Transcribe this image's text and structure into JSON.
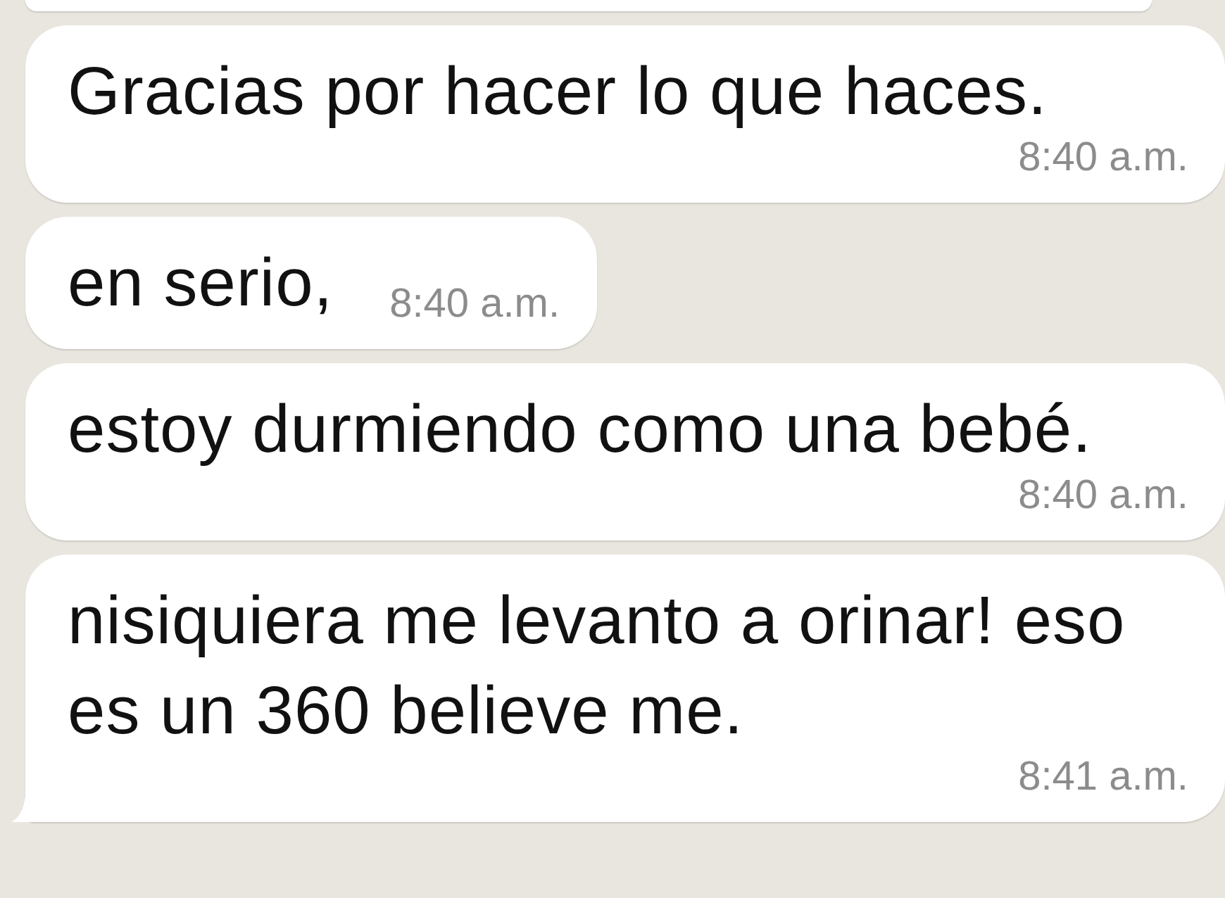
{
  "messages": [
    {
      "text": "Gracias por hacer lo que haces.",
      "time": "8:40 a.m.",
      "tail": false
    },
    {
      "text": "en serio,",
      "time": "8:40 a.m.",
      "tail": false
    },
    {
      "text": "estoy durmiendo como una bebé.",
      "time": "8:40 a.m.",
      "tail": false
    },
    {
      "text": "nisiquiera me levanto a orinar! eso es un 360 believe me.",
      "time": "8:41 a.m.",
      "tail": true
    }
  ]
}
